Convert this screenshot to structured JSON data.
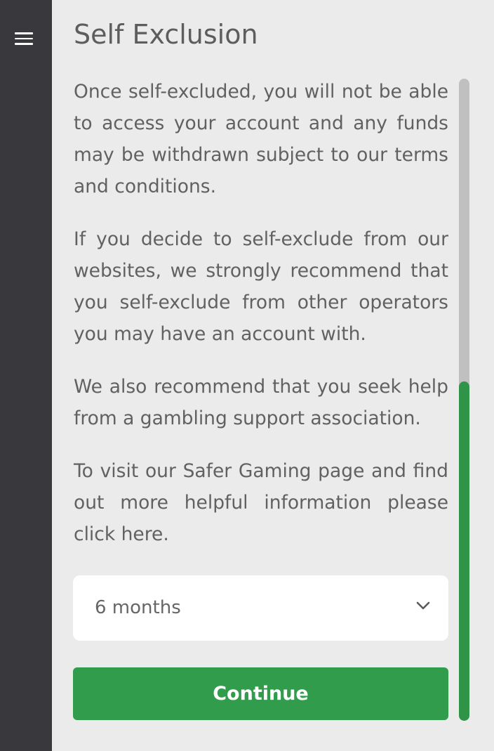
{
  "header": {
    "title": "Self Exclusion",
    "menu_icon": "hamburger-menu-icon"
  },
  "content": {
    "paragraphs": [
      "Once self-excluded, you will not be able to access your account and any funds may be withdrawn subject to our terms and conditions.",
      "If you decide to self-exclude from our websites, we strongly recommend that you self-exclude from other operators you may have an account with.",
      "We also recommend that you seek help from a gambling support association.",
      "To visit our Safer Gaming page and find out more helpful information please click here."
    ]
  },
  "period_select": {
    "selected": "6 months",
    "icon": "chevron-down-icon"
  },
  "actions": {
    "continue_label": "Continue"
  },
  "scrollbar": {
    "position_fraction": 1.0
  },
  "colors": {
    "sidebar": "#38383d",
    "background": "#ebebeb",
    "accent_green": "#319c4b",
    "text": "#616161"
  }
}
